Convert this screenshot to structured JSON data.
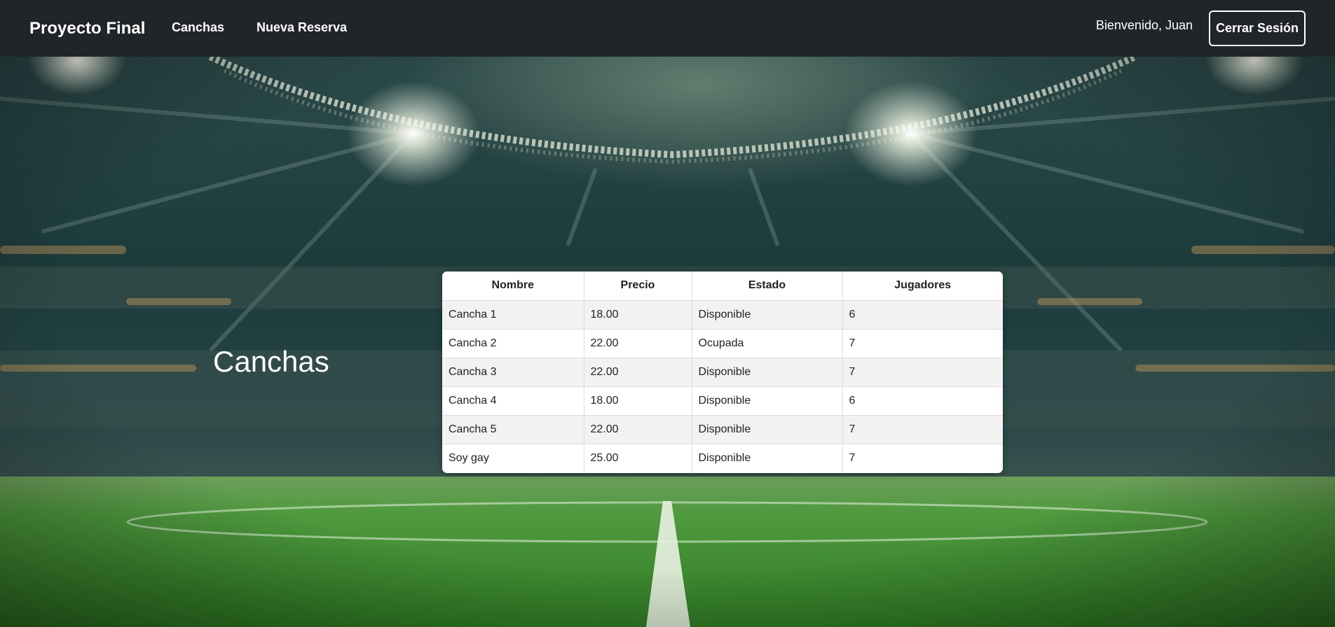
{
  "navbar": {
    "brand": "Proyecto Final",
    "links": [
      "Canchas",
      "Nueva Reserva"
    ],
    "welcome": "Bienvenido, Juan",
    "logout_label": "Cerrar Sesión"
  },
  "colors": {
    "navbar_bg": "#212529",
    "text_on_dark": "#ffffff",
    "row_striped": "#f2f2f2",
    "row_plain": "#ffffff"
  },
  "main": {
    "title": "Canchas",
    "table": {
      "headers": [
        "Nombre",
        "Precio",
        "Estado",
        "Jugadores"
      ],
      "rows": [
        [
          "Cancha 1",
          "18.00",
          "Disponible",
          "6"
        ],
        [
          "Cancha 2",
          "22.00",
          "Ocupada",
          "7"
        ],
        [
          "Cancha 3",
          "22.00",
          "Disponible",
          "7"
        ],
        [
          "Cancha 4",
          "18.00",
          "Disponible",
          "6"
        ],
        [
          "Cancha 5",
          "22.00",
          "Disponible",
          "7"
        ],
        [
          "Soy gay",
          "25.00",
          "Disponible",
          "7"
        ]
      ]
    }
  },
  "background": {
    "image": "stadium-floodlights-image"
  }
}
